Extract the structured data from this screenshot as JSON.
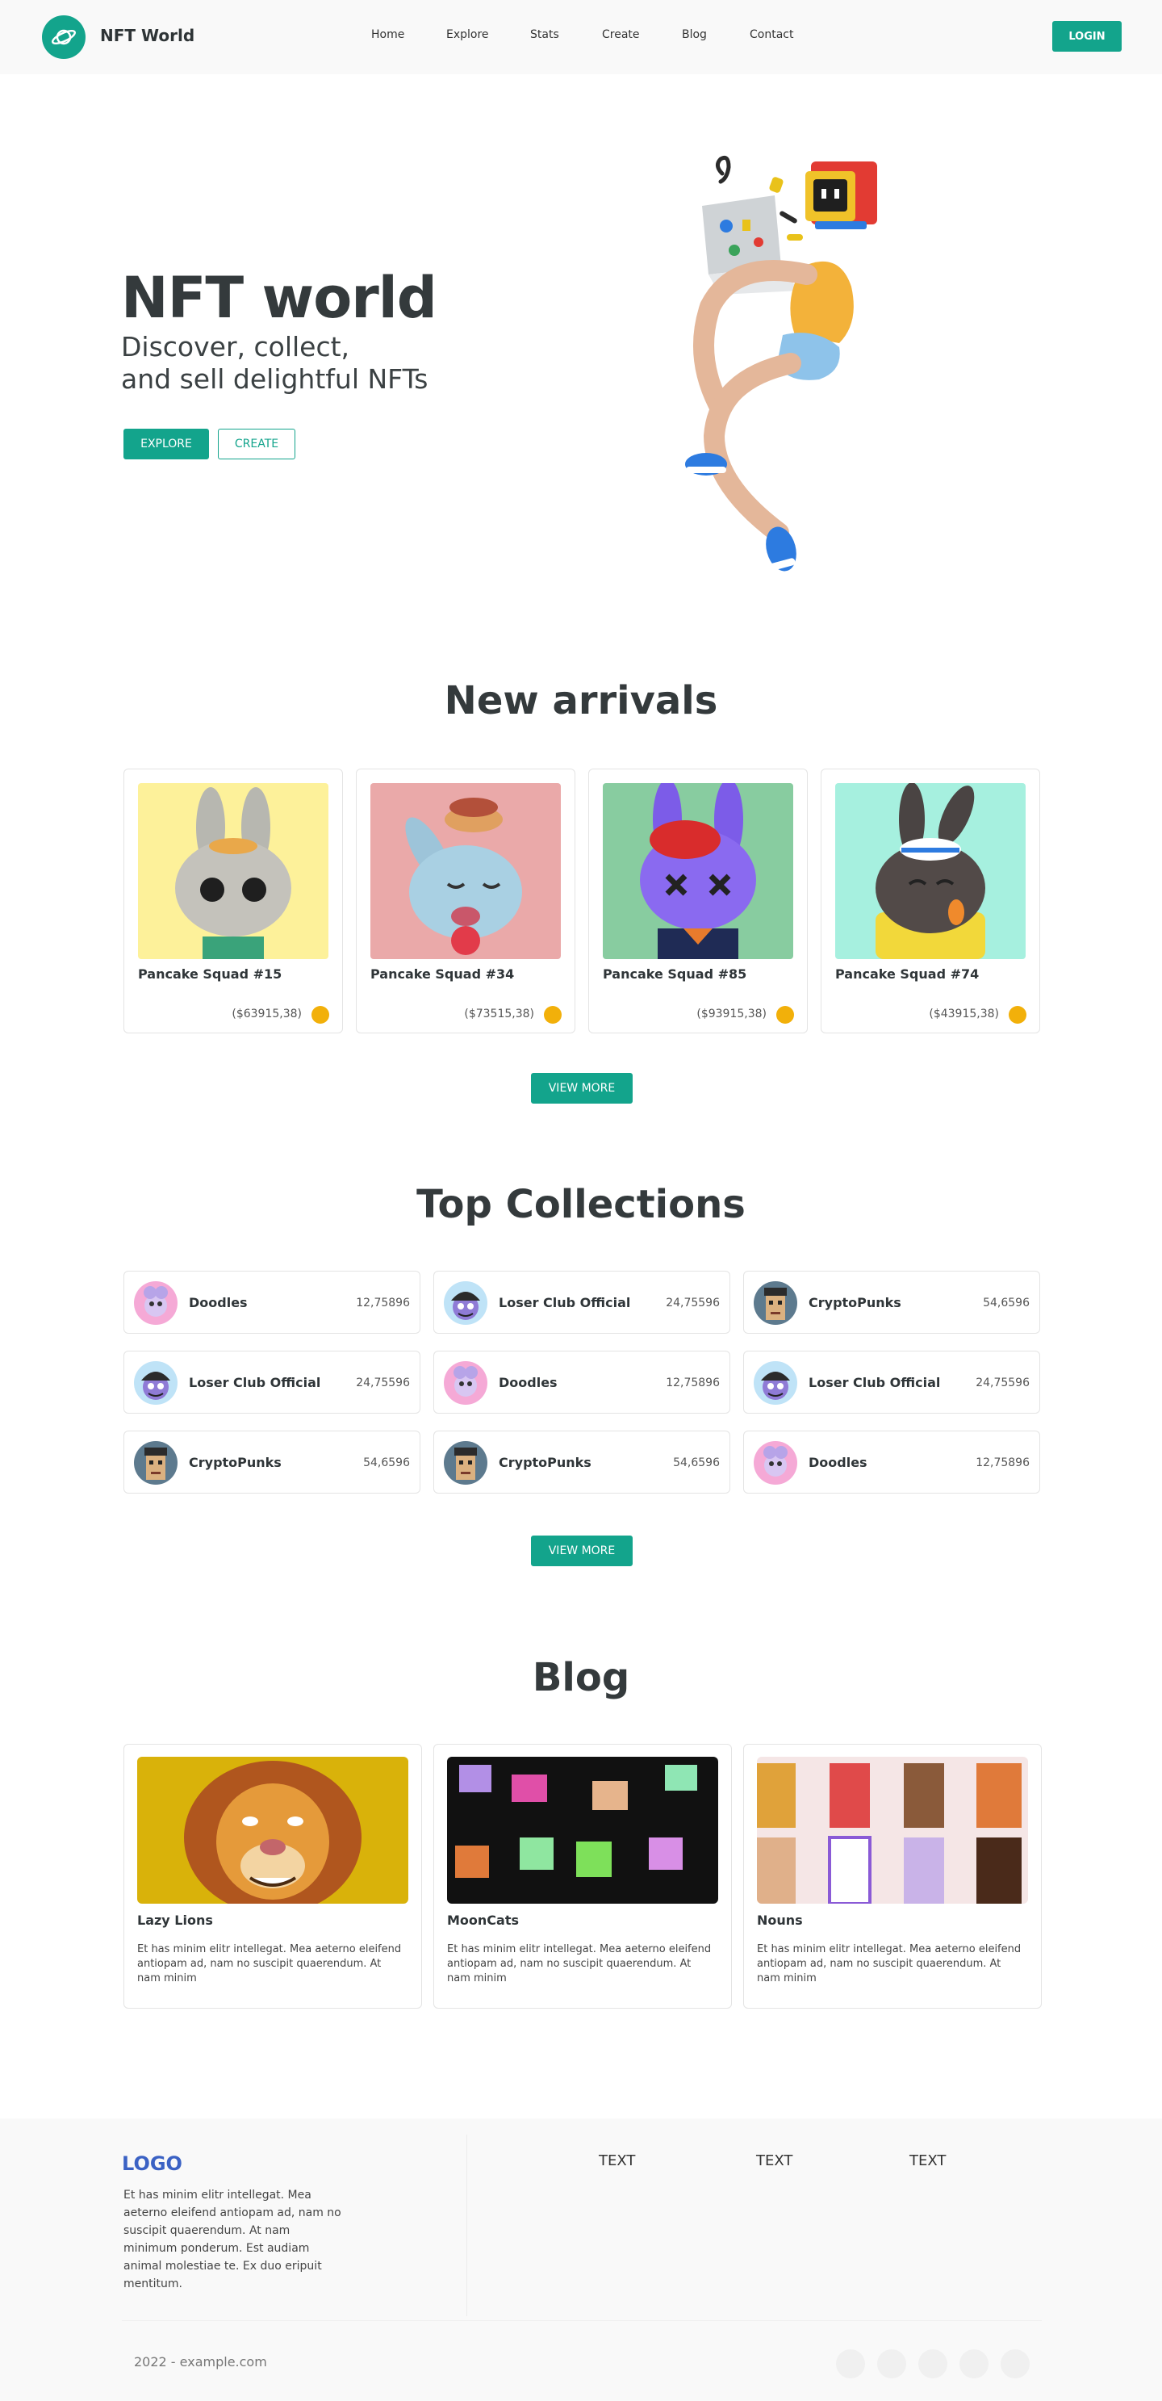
{
  "header": {
    "brand": "NFT World",
    "nav": [
      "Home",
      "Explore",
      "Stats",
      "Create",
      "Blog",
      "Contact"
    ],
    "login_label": "LOGIN"
  },
  "hero": {
    "title": "NFT world",
    "subtitle_line1": "Discover, collect,",
    "subtitle_line2": "and sell delightful NFTs",
    "explore_label": "EXPLORE",
    "create_label": "CREATE"
  },
  "arrivals": {
    "title": "New arrivals",
    "items": [
      {
        "name": "Pancake Squad #15",
        "price": "($63915,38)"
      },
      {
        "name": "Pancake Squad #34",
        "price": "($73515,38)"
      },
      {
        "name": "Pancake Squad #85",
        "price": "($93915,38)"
      },
      {
        "name": "Pancake Squad #74",
        "price": "($43915,38)"
      }
    ],
    "view_more": "VIEW MORE"
  },
  "collections": {
    "title": "Top Collections",
    "items": [
      {
        "name": "Doodles",
        "value": "12,75896"
      },
      {
        "name": "Loser Club Official",
        "value": "24,75596"
      },
      {
        "name": "CryptoPunks",
        "value": "54,6596"
      },
      {
        "name": "Loser Club Official",
        "value": "24,75596"
      },
      {
        "name": "Doodles",
        "value": "12,75896"
      },
      {
        "name": "Loser Club Official",
        "value": "24,75596"
      },
      {
        "name": "CryptoPunks",
        "value": "54,6596"
      },
      {
        "name": "CryptoPunks",
        "value": "54,6596"
      },
      {
        "name": "Doodles",
        "value": "12,75896"
      }
    ],
    "view_more": "VIEW MORE"
  },
  "blog": {
    "title": "Blog",
    "posts": [
      {
        "title": "Lazy Lions",
        "text": "Et has minim elitr intellegat. Mea aeterno eleifend antiopam ad, nam no suscipit quaerendum. At nam minim"
      },
      {
        "title": "MoonCats",
        "text": "Et has minim elitr intellegat. Mea aeterno eleifend antiopam ad, nam no suscipit quaerendum. At nam minim"
      },
      {
        "title": "Nouns",
        "text": "Et has minim elitr intellegat. Mea aeterno eleifend antiopam ad, nam no suscipit quaerendum. At nam minim"
      }
    ]
  },
  "footer": {
    "logo": "LOGO",
    "description": "Et has minim elitr intellegat. Mea aeterno eleifend antiopam ad, nam no suscipit quaerendum. At nam minimum ponderum. Est audiam animal molestiae te. Ex duo eripuit mentitum.",
    "columns": [
      "TEXT",
      "TEXT",
      "TEXT"
    ],
    "copyright": "2022 - example.com"
  },
  "colors": {
    "accent": "#13a48c",
    "coin": "#f2b00a",
    "footer_logo": "#3b62c4"
  }
}
